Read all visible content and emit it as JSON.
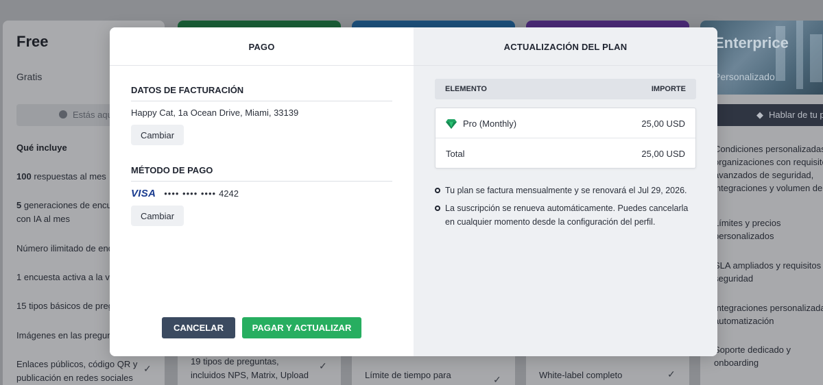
{
  "background": {
    "free": {
      "title": "Free",
      "subtitle": "Gratis",
      "current_button": "Estás aqu",
      "includes_heading": "Qué incluye",
      "features": [
        {
          "bold": "100",
          "text": " respuestas al mes"
        },
        {
          "bold": "5",
          "text": " generaciones de encu"
        },
        {
          "bold": "",
          "text": "con IA al mes"
        },
        {
          "bold": "",
          "text": "Número ilimitado de enc"
        },
        {
          "bold": "",
          "text": "1 encuesta activa a la ve"
        },
        {
          "bold": "",
          "text": "15 tipos básicos de preg"
        },
        {
          "bold": "",
          "text": "Imágenes en las pregunt"
        },
        {
          "bold": "",
          "text": "Enlaces públicos, código QR y"
        },
        {
          "bold": "",
          "text": "publicación en redes sociales"
        }
      ]
    },
    "pro_feature_lines": [
      "19 tipos de preguntas,",
      "incluidos NPS, Matrix, Upload"
    ],
    "business_feature": "Límite de tiempo para",
    "premium_feature": "White-label completo",
    "enterprise": {
      "title": "Enterprice",
      "subtitle": "Personalizado",
      "button": "Hablar de tu plan",
      "features": [
        "Condiciones personalizadas",
        "organizaciones con requisito",
        "avanzados de seguridad,",
        "integraciones y volumen de d",
        "Límites y precios",
        "personalizados",
        "SLA ampliados y requisitos d",
        "seguridad",
        "Integraciones personalizadas",
        "automatización",
        "Soporte dedicado y",
        "onboarding"
      ]
    }
  },
  "modal": {
    "left_tab": "PAGO",
    "right_tab": "ACTUALIZACIÓN DEL PLAN",
    "billing": {
      "title": "DATOS DE FACTURACIÓN",
      "address": "Happy Cat, 1a Ocean Drive, Miami, 33139",
      "change_label": "Cambiar"
    },
    "payment": {
      "title": "MÉTODO DE PAGO",
      "brand": "VISA",
      "masked": "•••• •••• ••••",
      "last4": "4242",
      "change_label": "Cambiar"
    },
    "cancel_label": "CANCELAR",
    "pay_label": "PAGAR Y ACTUALIZAR",
    "table": {
      "col_item": "ELEMENTO",
      "col_amount": "IMPORTE",
      "item_name": "Pro (Monthly)",
      "item_amount": "25,00 USD",
      "total_label": "Total",
      "total_amount": "25,00 USD"
    },
    "notes": [
      "Tu plan se factura mensualmente y se renovará el Jul 29, 2026.",
      "La suscripción se renueva automáticamente. Puedes cancelarla en cualquier momento desde la configuración del perfil."
    ],
    "colors": {
      "primary_green": "#27ae60",
      "cancel_navy": "#3b4a60",
      "gem_green": "#1fa463"
    }
  }
}
